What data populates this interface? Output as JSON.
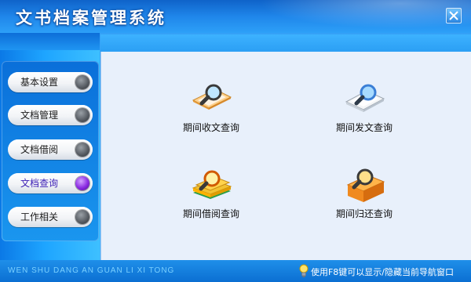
{
  "app": {
    "title": "文书档案管理系统"
  },
  "sidebar": {
    "items": [
      {
        "label": "基本设置"
      },
      {
        "label": "文档管理"
      },
      {
        "label": "文档借阅"
      },
      {
        "label": "文档查询",
        "active": true
      },
      {
        "label": "工作相关"
      }
    ]
  },
  "main": {
    "items": [
      {
        "label": "期间收文查询",
        "icon": "folder-magnifier-icon"
      },
      {
        "label": "期间发文查询",
        "icon": "paper-magnifier-icon"
      },
      {
        "label": "期间借阅查询",
        "icon": "books-magnifier-icon"
      },
      {
        "label": "期间归还查询",
        "icon": "box-magnifier-icon"
      }
    ]
  },
  "footer": {
    "left_text": "WEN SHU DANG AN GUAN LI XI TONG",
    "hint": "使用F8键可以显示/隐藏当前导航窗口"
  },
  "colors": {
    "accent": "#1f86ea",
    "active_knob": "#8a2be2"
  }
}
